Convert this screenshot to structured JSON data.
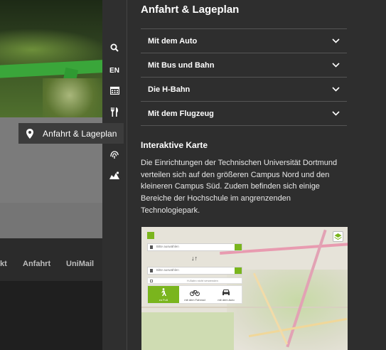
{
  "background": {
    "nav_links": [
      "kt",
      "Anfahrt",
      "UniMail"
    ]
  },
  "tooltip": {
    "label": "Anfahrt & Lageplan",
    "icon": "map-pin-icon"
  },
  "rail": {
    "language": "EN",
    "icons": [
      "search-icon",
      "calendar-icon",
      "cutlery-icon",
      "location-marker-icon",
      "map-icon"
    ]
  },
  "panel": {
    "title": "Anfahrt & Lageplan",
    "accordion": [
      {
        "label": "Mit dem Auto"
      },
      {
        "label": "Mit Bus und Bahn"
      },
      {
        "label": "Die H-Bahn"
      },
      {
        "label": "Mit dem Flugzeug"
      }
    ],
    "map_heading": "Interaktive Karte",
    "map_text": "Die Einrichtungen der Technischen Universität Dortmund verteilen sich auf den größeren Campus Nord und den kleineren Campus Süd. Zudem befinden sich einige Bereiche der Hochschule im angrenzenden Technologiepark."
  },
  "map": {
    "from_placeholder": "Bitte auswählen",
    "to_placeholder": "Bitte auswählen",
    "hbahn_option": "H-Bahn nicht verwenden",
    "modes": [
      {
        "label": "zu Fuß",
        "icon": "walking-icon"
      },
      {
        "label": "mit dem Fahrrad",
        "icon": "bicycle-icon"
      },
      {
        "label": "mit dem Auto",
        "icon": "car-icon"
      }
    ],
    "accent": "#7ab51d"
  }
}
